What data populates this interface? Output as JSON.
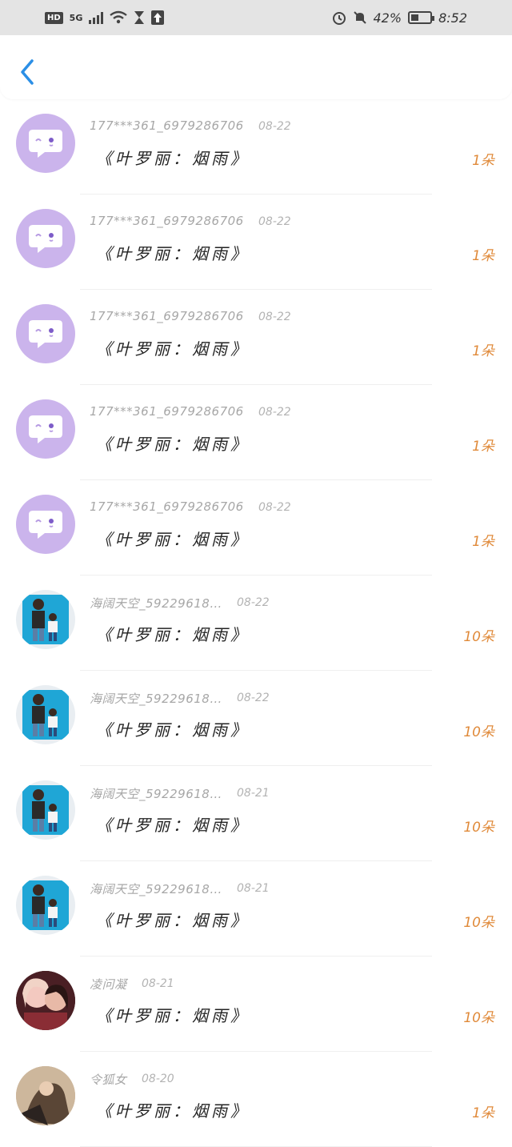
{
  "status_bar": {
    "hd": "HD",
    "network": "5G",
    "battery_text": "42%",
    "battery_level": 0.42,
    "time": "8:52"
  },
  "header": {
    "back_icon": "chevron-left-icon",
    "accent": "#2b8fe6"
  },
  "items": [
    {
      "name": "177***361_6979286706",
      "date": "08-22",
      "title": "《叶罗丽：烟雨》",
      "count": "1朵",
      "avatar": "default"
    },
    {
      "name": "177***361_6979286706",
      "date": "08-22",
      "title": "《叶罗丽：烟雨》",
      "count": "1朵",
      "avatar": "default"
    },
    {
      "name": "177***361_6979286706",
      "date": "08-22",
      "title": "《叶罗丽：烟雨》",
      "count": "1朵",
      "avatar": "default"
    },
    {
      "name": "177***361_6979286706",
      "date": "08-22",
      "title": "《叶罗丽：烟雨》",
      "count": "1朵",
      "avatar": "default"
    },
    {
      "name": "177***361_6979286706",
      "date": "08-22",
      "title": "《叶罗丽：烟雨》",
      "count": "1朵",
      "avatar": "default"
    },
    {
      "name": "海阔天空_59229618…",
      "date": "08-22",
      "title": "《叶罗丽：烟雨》",
      "count": "10朵",
      "avatar": "photo-family"
    },
    {
      "name": "海阔天空_59229618…",
      "date": "08-22",
      "title": "《叶罗丽：烟雨》",
      "count": "10朵",
      "avatar": "photo-family"
    },
    {
      "name": "海阔天空_59229618…",
      "date": "08-21",
      "title": "《叶罗丽：烟雨》",
      "count": "10朵",
      "avatar": "photo-family"
    },
    {
      "name": "海阔天空_59229618…",
      "date": "08-21",
      "title": "《叶罗丽：烟雨》",
      "count": "10朵",
      "avatar": "photo-family"
    },
    {
      "name": "凌问凝",
      "date": "08-21",
      "title": "《叶罗丽：烟雨》",
      "count": "10朵",
      "avatar": "photo-girls"
    },
    {
      "name": "令狐女",
      "date": "08-20",
      "title": "《叶罗丽：烟雨》",
      "count": "1朵",
      "avatar": "photo-girl2"
    }
  ],
  "colors": {
    "count": "#e08a3a",
    "avatar_default": "#cbb4ec"
  }
}
